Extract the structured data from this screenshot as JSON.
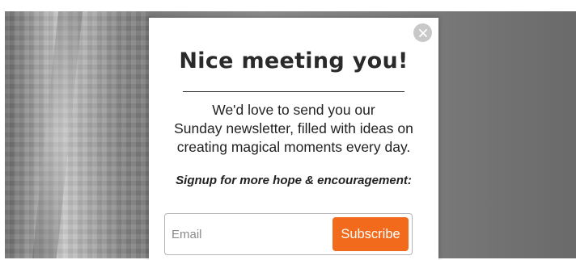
{
  "modal": {
    "title": "Nice meeting you!",
    "body_lines": [
      "We'd love to send you our",
      "Sunday newsletter, filled with ideas on",
      "creating magical moments every day."
    ],
    "cta": "Signup for more hope & encouragement:",
    "close_icon": "close-icon",
    "form": {
      "email_placeholder": "Email",
      "email_value": "",
      "subscribe_label": "Subscribe",
      "subscribe_color": "#f26a1b"
    }
  }
}
